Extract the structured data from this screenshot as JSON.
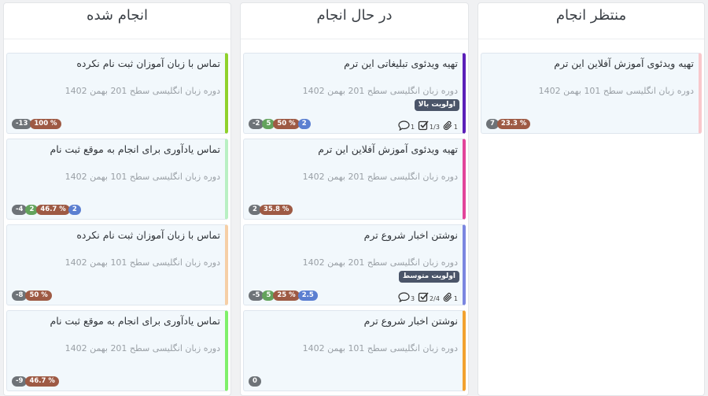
{
  "columns": {
    "done": {
      "title": "انجام شده",
      "cards": [
        {
          "title": "تماس با زبان آموزان ثبت نام نکرده",
          "subtitle": "دوره زبان انگلیسی سطح 201 بهمن 1402",
          "badges": [
            "-13",
            "100 %"
          ],
          "accent": "#8fd12c"
        },
        {
          "title": "تماس یادآوری برای انجام به موقع ثبت نام",
          "subtitle": "دوره زبان انگلیسی سطح 101 بهمن 1402",
          "badges": [
            "-4",
            "2",
            "46.7 %",
            "2"
          ],
          "accent": "#b9f0c3"
        },
        {
          "title": "تماس با زبان آموزان ثبت نام نکرده",
          "subtitle": "دوره زبان انگلیسی سطح 101 بهمن 1402",
          "badges": [
            "-8",
            "50 %"
          ],
          "accent": "#f6cfa6"
        },
        {
          "title": "تماس یادآوری برای انجام به موقع ثبت نام",
          "subtitle": "دوره زبان انگلیسی سطح 201 بهمن 1402",
          "badges": [
            "-9",
            "46.7 %"
          ],
          "accent": "#7ff06a"
        }
      ]
    },
    "progress": {
      "title": "در حال انجام",
      "cards": [
        {
          "title": "تهیه ویدئوی تبلیغاتی این ترم",
          "subtitle": "دوره زبان انگلیسی سطح 201 بهمن 1402",
          "priority": "اولویت بالا",
          "badges": [
            "-2",
            "5",
            "50 %",
            "2"
          ],
          "meta": {
            "comments": "1",
            "checklist": "1/3",
            "attachments": "1"
          },
          "accent": "#5b1fb8"
        },
        {
          "title": "تهیه ویدئوی آموزش آفلاین این ترم",
          "subtitle": "دوره زبان انگلیسی سطح 201 بهمن 1402",
          "badges": [
            "2",
            "35.8 %"
          ],
          "accent": "#e2449a"
        },
        {
          "title": "نوشتن اخبار شروع ترم",
          "subtitle": "دوره زبان انگلیسی سطح 201 بهمن 1402",
          "priority": "اولویت متوسط",
          "badges": [
            "-5",
            "5",
            "25 %",
            "2.5"
          ],
          "meta": {
            "comments": "3",
            "checklist": "2/4",
            "attachments": "1"
          },
          "accent": "#7b86e0"
        },
        {
          "title": "نوشتن اخبار شروع ترم",
          "subtitle": "دوره زبان انگلیسی سطح 101 بهمن 1402",
          "badges": [
            "0"
          ],
          "accent": "#f2a230"
        }
      ]
    },
    "todo": {
      "title": "منتظر انجام",
      "cards": [
        {
          "title": "تهیه ویدئوی آموزش آفلاین این ترم",
          "subtitle": "دوره زبان انگلیسی سطح 101 بهمن 1402",
          "badges": [
            "7",
            "23.3 %"
          ],
          "accent": "#f8c8cc"
        }
      ]
    }
  }
}
